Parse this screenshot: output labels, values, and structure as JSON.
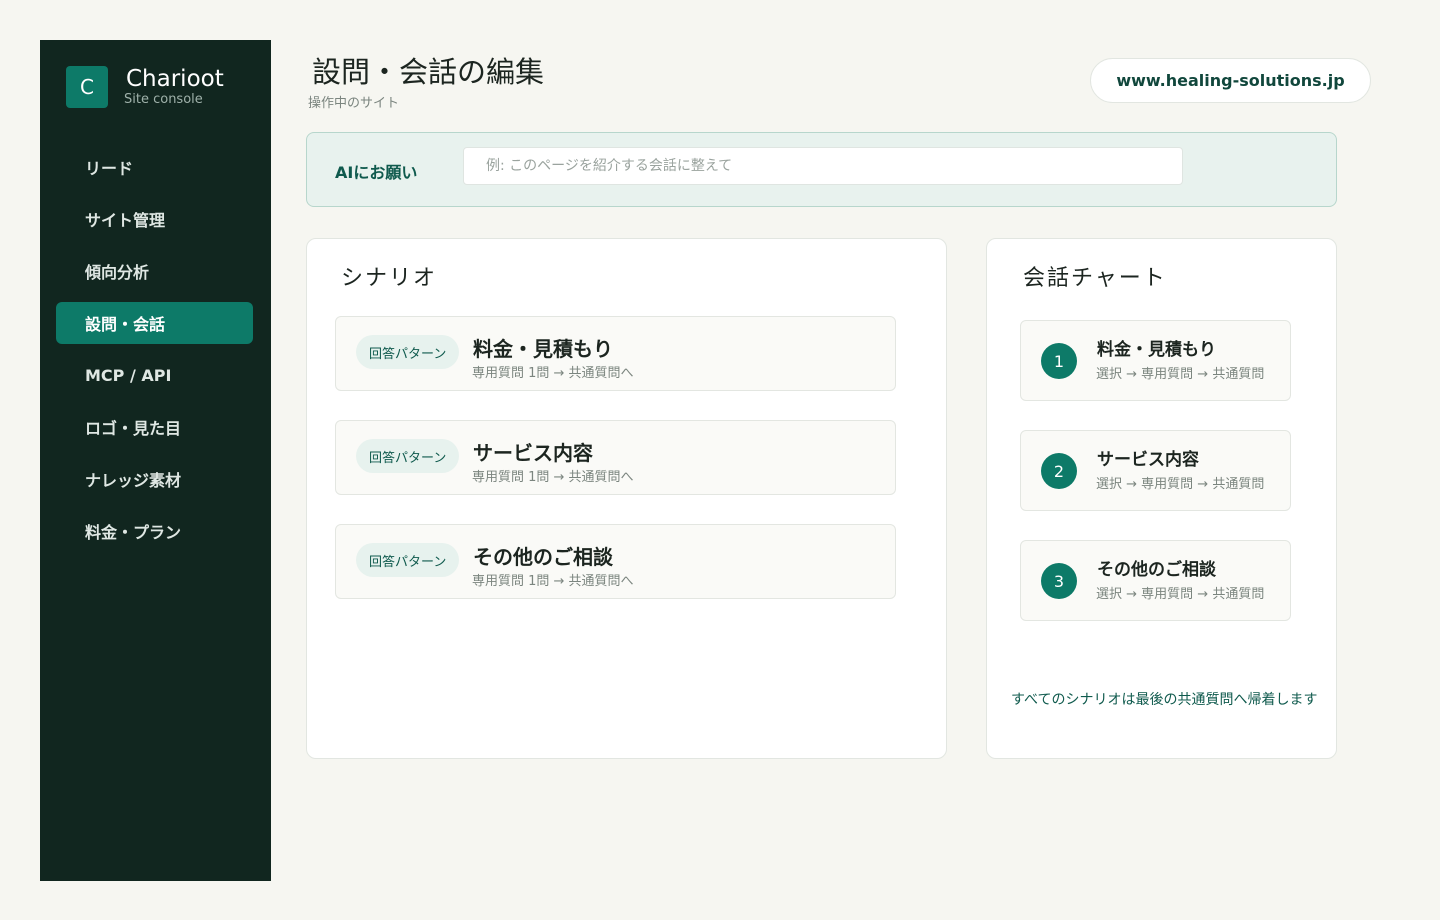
{
  "sidebar": {
    "brand": {
      "logo_letter": "C",
      "name": "Charioot",
      "subtitle": "Site console"
    },
    "items": [
      {
        "label": "リード",
        "active": false
      },
      {
        "label": "サイト管理",
        "active": false
      },
      {
        "label": "傾向分析",
        "active": false
      },
      {
        "label": "設問・会話",
        "active": true
      },
      {
        "label": "MCP / API",
        "active": false
      },
      {
        "label": "ロゴ・見た目",
        "active": false
      },
      {
        "label": "ナレッジ素材",
        "active": false
      },
      {
        "label": "料金・プラン",
        "active": false
      }
    ]
  },
  "header": {
    "title": "設問・会話の編集",
    "subtitle": "操作中のサイト",
    "site": "www.healing-solutions.jp"
  },
  "ai_bar": {
    "label": "AIにお願い",
    "placeholder": "例: このページを紹介する会話に整えて",
    "value": ""
  },
  "scenarios": {
    "title": "シナリオ",
    "items": [
      {
        "badge": "回答パターン",
        "name": "料金・見積もり",
        "flow": "専用質問 1問 → 共通質問へ"
      },
      {
        "badge": "回答パターン",
        "name": "サービス内容",
        "flow": "専用質問 1問 → 共通質問へ"
      },
      {
        "badge": "回答パターン",
        "name": "その他のご相談",
        "flow": "専用質問 1問 → 共通質問へ"
      }
    ]
  },
  "chart": {
    "title": "会話チャート",
    "steps": [
      {
        "num": "1",
        "name": "料金・見積もり",
        "flow": "選択 → 専用質問 → 共通質問"
      },
      {
        "num": "2",
        "name": "サービス内容",
        "flow": "選択 → 専用質問 → 共通質問"
      },
      {
        "num": "3",
        "name": "その他のご相談",
        "flow": "選択 → 専用質問 → 共通質問"
      }
    ],
    "note": "すべてのシナリオは最後の共通質問へ帰着します"
  },
  "colors": {
    "background": "#f6f6f1",
    "sidebar": "#11261f",
    "accent": "#0d7a68",
    "accent_text": "#0f5a4d"
  }
}
